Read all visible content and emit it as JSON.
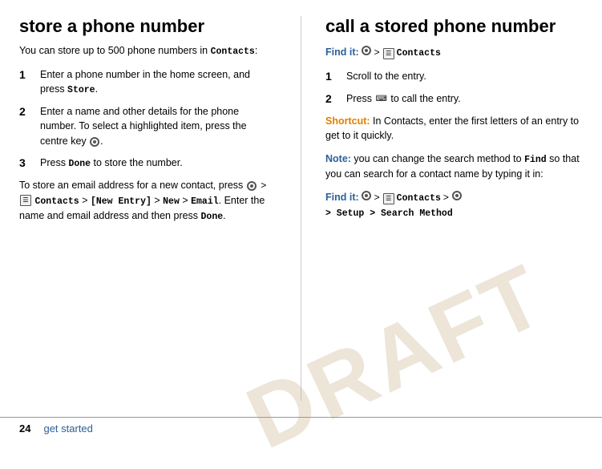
{
  "left": {
    "title": "store a phone number",
    "intro": "You can store up to 500 phone numbers in",
    "intro_bold": "Contacts",
    "intro_colon": ":",
    "steps": [
      {
        "number": "1",
        "text_before": "Enter a phone number in the home screen, and press ",
        "text_bold": "Store",
        "text_after": "."
      },
      {
        "number": "2",
        "text_before": "Enter a name and other details for the phone number. To select a highlighted item, press the centre key ",
        "text_after": "."
      },
      {
        "number": "3",
        "text_before": "Press ",
        "text_bold": "Done",
        "text_after": " to store the number."
      }
    ],
    "note_text": "To store an email address for a new contact, press",
    "note_nav": " > ",
    "note_contacts": "Contacts",
    "note_nav2": " > [New Entry] > New > Email",
    "note_end": ". Enter the name and email address and then press ",
    "note_done": "Done",
    "note_period": "."
  },
  "right": {
    "title": "call a stored phone number",
    "find_it_label": "Find it:",
    "find_it_nav": " > ",
    "find_it_contacts": "Contacts",
    "steps": [
      {
        "number": "1",
        "text": "Scroll to the entry."
      },
      {
        "number": "2",
        "text_before": "Press ",
        "text_after": " to call the entry."
      }
    ],
    "shortcut_label": "Shortcut:",
    "shortcut_text": " In Contacts, enter the first letters of an entry to get to it quickly.",
    "note_label": "Note:",
    "note_text": " you can change the search method to ",
    "note_find": "Find",
    "note_text2": " so that you can search for a contact name by typing it in:",
    "find_it2_label": "Find it:",
    "find_it2_nav": " > ",
    "find_it2_contacts": "Contacts",
    "find_it2_nav2": " > ",
    "find_it2_setup": " > Setup > Search Method"
  },
  "footer": {
    "page_number": "24",
    "page_label": "get started"
  },
  "watermark": "DRAFT"
}
